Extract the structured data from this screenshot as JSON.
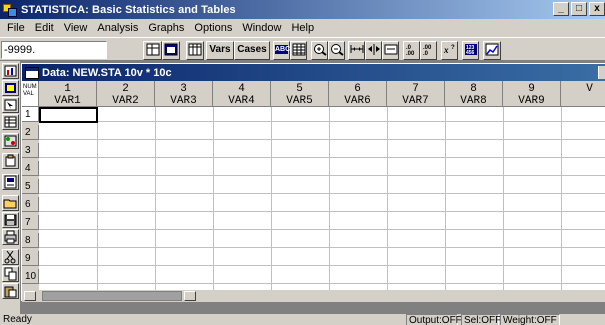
{
  "window": {
    "title": "STATISTICA: Basic Statistics and Tables",
    "buttons": [
      "_",
      "□",
      "x"
    ]
  },
  "menu": [
    {
      "label": "File",
      "key": "menu-file"
    },
    {
      "label": "Edit",
      "key": "menu-edit"
    },
    {
      "label": "View",
      "key": "menu-view"
    },
    {
      "label": "Analysis",
      "key": "menu-analysis"
    },
    {
      "label": "Graphs",
      "key": "menu-graphs"
    },
    {
      "label": "Options",
      "key": "menu-options"
    },
    {
      "label": "Window",
      "key": "menu-window"
    },
    {
      "label": "Help",
      "key": "menu-help"
    }
  ],
  "toolbar": {
    "value_field": "-9999.",
    "vars_label": "Vars",
    "cases_label": "Cases",
    "abc_label": "ABC",
    "decimals_label": ".00"
  },
  "data_window": {
    "title": "Data: NEW.STA 10v * 10c",
    "info_lines": [
      "NUM",
      "VAL"
    ]
  },
  "columns": [
    {
      "num": "1",
      "name": "VAR1"
    },
    {
      "num": "2",
      "name": "VAR2"
    },
    {
      "num": "3",
      "name": "VAR3"
    },
    {
      "num": "4",
      "name": "VAR4"
    },
    {
      "num": "5",
      "name": "VAR5"
    },
    {
      "num": "6",
      "name": "VAR6"
    },
    {
      "num": "7",
      "name": "VAR7"
    },
    {
      "num": "8",
      "name": "VAR8"
    },
    {
      "num": "9",
      "name": "VAR9"
    },
    {
      "num": "",
      "name": "V"
    }
  ],
  "rows": [
    "1",
    "2",
    "3",
    "4",
    "5",
    "6",
    "7",
    "8",
    "9",
    "10"
  ],
  "status": {
    "ready": "Ready",
    "output": "Output:OFF",
    "sel": "Sel:OFF",
    "weight": "Weight:OFF"
  },
  "colors": {
    "titlebar_start": "#0a246a",
    "titlebar_end": "#a6caf0",
    "face": "#d4d0c8",
    "workspace": "#808080"
  }
}
